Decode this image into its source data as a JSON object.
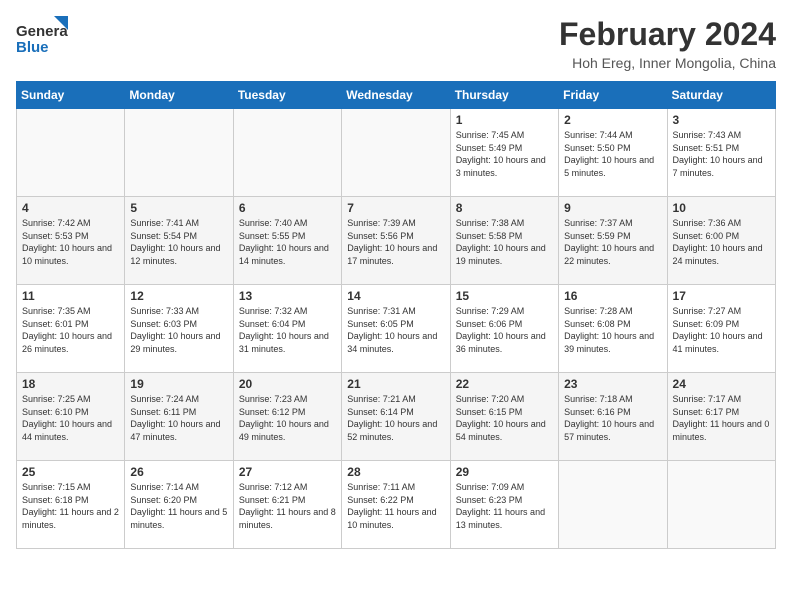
{
  "header": {
    "logo_line1": "General",
    "logo_line2": "Blue",
    "month_year": "February 2024",
    "location": "Hoh Ereg, Inner Mongolia, China"
  },
  "days_of_week": [
    "Sunday",
    "Monday",
    "Tuesday",
    "Wednesday",
    "Thursday",
    "Friday",
    "Saturday"
  ],
  "weeks": [
    [
      {
        "day": "",
        "sunrise": "",
        "sunset": "",
        "daylight": ""
      },
      {
        "day": "",
        "sunrise": "",
        "sunset": "",
        "daylight": ""
      },
      {
        "day": "",
        "sunrise": "",
        "sunset": "",
        "daylight": ""
      },
      {
        "day": "",
        "sunrise": "",
        "sunset": "",
        "daylight": ""
      },
      {
        "day": "1",
        "sunrise": "Sunrise: 7:45 AM",
        "sunset": "Sunset: 5:49 PM",
        "daylight": "Daylight: 10 hours and 3 minutes."
      },
      {
        "day": "2",
        "sunrise": "Sunrise: 7:44 AM",
        "sunset": "Sunset: 5:50 PM",
        "daylight": "Daylight: 10 hours and 5 minutes."
      },
      {
        "day": "3",
        "sunrise": "Sunrise: 7:43 AM",
        "sunset": "Sunset: 5:51 PM",
        "daylight": "Daylight: 10 hours and 7 minutes."
      }
    ],
    [
      {
        "day": "4",
        "sunrise": "Sunrise: 7:42 AM",
        "sunset": "Sunset: 5:53 PM",
        "daylight": "Daylight: 10 hours and 10 minutes."
      },
      {
        "day": "5",
        "sunrise": "Sunrise: 7:41 AM",
        "sunset": "Sunset: 5:54 PM",
        "daylight": "Daylight: 10 hours and 12 minutes."
      },
      {
        "day": "6",
        "sunrise": "Sunrise: 7:40 AM",
        "sunset": "Sunset: 5:55 PM",
        "daylight": "Daylight: 10 hours and 14 minutes."
      },
      {
        "day": "7",
        "sunrise": "Sunrise: 7:39 AM",
        "sunset": "Sunset: 5:56 PM",
        "daylight": "Daylight: 10 hours and 17 minutes."
      },
      {
        "day": "8",
        "sunrise": "Sunrise: 7:38 AM",
        "sunset": "Sunset: 5:58 PM",
        "daylight": "Daylight: 10 hours and 19 minutes."
      },
      {
        "day": "9",
        "sunrise": "Sunrise: 7:37 AM",
        "sunset": "Sunset: 5:59 PM",
        "daylight": "Daylight: 10 hours and 22 minutes."
      },
      {
        "day": "10",
        "sunrise": "Sunrise: 7:36 AM",
        "sunset": "Sunset: 6:00 PM",
        "daylight": "Daylight: 10 hours and 24 minutes."
      }
    ],
    [
      {
        "day": "11",
        "sunrise": "Sunrise: 7:35 AM",
        "sunset": "Sunset: 6:01 PM",
        "daylight": "Daylight: 10 hours and 26 minutes."
      },
      {
        "day": "12",
        "sunrise": "Sunrise: 7:33 AM",
        "sunset": "Sunset: 6:03 PM",
        "daylight": "Daylight: 10 hours and 29 minutes."
      },
      {
        "day": "13",
        "sunrise": "Sunrise: 7:32 AM",
        "sunset": "Sunset: 6:04 PM",
        "daylight": "Daylight: 10 hours and 31 minutes."
      },
      {
        "day": "14",
        "sunrise": "Sunrise: 7:31 AM",
        "sunset": "Sunset: 6:05 PM",
        "daylight": "Daylight: 10 hours and 34 minutes."
      },
      {
        "day": "15",
        "sunrise": "Sunrise: 7:29 AM",
        "sunset": "Sunset: 6:06 PM",
        "daylight": "Daylight: 10 hours and 36 minutes."
      },
      {
        "day": "16",
        "sunrise": "Sunrise: 7:28 AM",
        "sunset": "Sunset: 6:08 PM",
        "daylight": "Daylight: 10 hours and 39 minutes."
      },
      {
        "day": "17",
        "sunrise": "Sunrise: 7:27 AM",
        "sunset": "Sunset: 6:09 PM",
        "daylight": "Daylight: 10 hours and 41 minutes."
      }
    ],
    [
      {
        "day": "18",
        "sunrise": "Sunrise: 7:25 AM",
        "sunset": "Sunset: 6:10 PM",
        "daylight": "Daylight: 10 hours and 44 minutes."
      },
      {
        "day": "19",
        "sunrise": "Sunrise: 7:24 AM",
        "sunset": "Sunset: 6:11 PM",
        "daylight": "Daylight: 10 hours and 47 minutes."
      },
      {
        "day": "20",
        "sunrise": "Sunrise: 7:23 AM",
        "sunset": "Sunset: 6:12 PM",
        "daylight": "Daylight: 10 hours and 49 minutes."
      },
      {
        "day": "21",
        "sunrise": "Sunrise: 7:21 AM",
        "sunset": "Sunset: 6:14 PM",
        "daylight": "Daylight: 10 hours and 52 minutes."
      },
      {
        "day": "22",
        "sunrise": "Sunrise: 7:20 AM",
        "sunset": "Sunset: 6:15 PM",
        "daylight": "Daylight: 10 hours and 54 minutes."
      },
      {
        "day": "23",
        "sunrise": "Sunrise: 7:18 AM",
        "sunset": "Sunset: 6:16 PM",
        "daylight": "Daylight: 10 hours and 57 minutes."
      },
      {
        "day": "24",
        "sunrise": "Sunrise: 7:17 AM",
        "sunset": "Sunset: 6:17 PM",
        "daylight": "Daylight: 11 hours and 0 minutes."
      }
    ],
    [
      {
        "day": "25",
        "sunrise": "Sunrise: 7:15 AM",
        "sunset": "Sunset: 6:18 PM",
        "daylight": "Daylight: 11 hours and 2 minutes."
      },
      {
        "day": "26",
        "sunrise": "Sunrise: 7:14 AM",
        "sunset": "Sunset: 6:20 PM",
        "daylight": "Daylight: 11 hours and 5 minutes."
      },
      {
        "day": "27",
        "sunrise": "Sunrise: 7:12 AM",
        "sunset": "Sunset: 6:21 PM",
        "daylight": "Daylight: 11 hours and 8 minutes."
      },
      {
        "day": "28",
        "sunrise": "Sunrise: 7:11 AM",
        "sunset": "Sunset: 6:22 PM",
        "daylight": "Daylight: 11 hours and 10 minutes."
      },
      {
        "day": "29",
        "sunrise": "Sunrise: 7:09 AM",
        "sunset": "Sunset: 6:23 PM",
        "daylight": "Daylight: 11 hours and 13 minutes."
      },
      {
        "day": "",
        "sunrise": "",
        "sunset": "",
        "daylight": ""
      },
      {
        "day": "",
        "sunrise": "",
        "sunset": "",
        "daylight": ""
      }
    ]
  ]
}
